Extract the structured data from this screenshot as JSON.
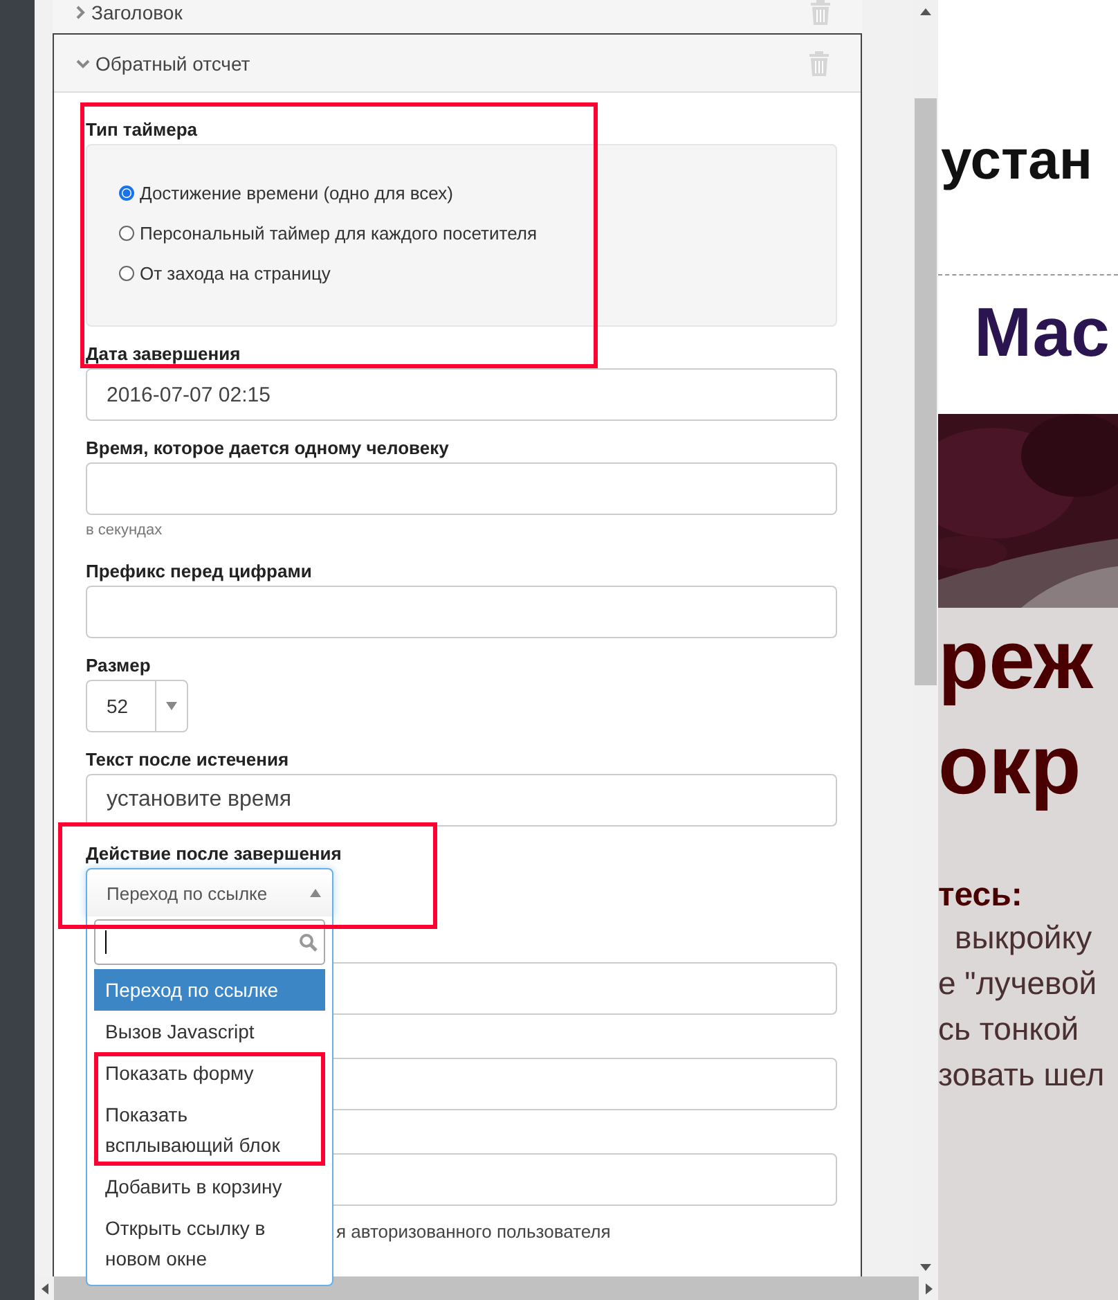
{
  "sections": [
    {
      "title": "Заголовок",
      "expanded": false
    },
    {
      "title": "Обратный отсчет",
      "expanded": true
    }
  ],
  "form": {
    "timer_type": {
      "label": "Тип таймера",
      "highlighted": true,
      "options": [
        {
          "label": "Достижение времени (одно для всех)",
          "selected": true
        },
        {
          "label": "Персональный таймер для каждого посетителя",
          "selected": false
        },
        {
          "label": "От захода на страницу",
          "selected": false
        }
      ]
    },
    "end_date": {
      "label": "Дата завершения",
      "value": "2016-07-07 02:15"
    },
    "person_time": {
      "label": "Время, которое дается одному человеку",
      "hint": "в секундах"
    },
    "prefix": {
      "label": "Префикс перед цифрами"
    },
    "size": {
      "label": "Размер",
      "value": "52"
    },
    "expired_text": {
      "label": "Текст после истечения",
      "value": "установите время"
    },
    "action": {
      "label": "Действие после завершения",
      "value": "Переход по ссылке",
      "highlighted": true,
      "open": true,
      "options": [
        {
          "label": "Переход по ссылке",
          "selected": true,
          "highlighted": false
        },
        {
          "label": "Вызов Javascript",
          "selected": false,
          "highlighted": false
        },
        {
          "label": "Показать форму",
          "selected": false,
          "highlighted": true
        },
        {
          "label": "Показать всплывающий блок",
          "selected": false,
          "highlighted": true
        },
        {
          "label": "Добавить в корзину",
          "selected": false,
          "highlighted": false
        },
        {
          "label": "Открыть ссылку в новом окне",
          "selected": false,
          "highlighted": false
        }
      ]
    },
    "auth_text": "я авторизованного пользователя"
  },
  "preview": {
    "lines": [
      {
        "kind": "heading",
        "text": "устан"
      },
      {
        "kind": "title",
        "text": "Мас"
      },
      {
        "kind": "picture"
      },
      {
        "kind": "big",
        "text": "реж"
      },
      {
        "kind": "big",
        "text": "окр"
      },
      {
        "kind": "subhead",
        "text": "тесь:"
      },
      {
        "kind": "body",
        "text": "выкройку"
      },
      {
        "kind": "body",
        "text": "е \"лучевой"
      },
      {
        "kind": "body",
        "text": "сь тонкой"
      },
      {
        "kind": "body",
        "text": "зовать шел"
      }
    ]
  }
}
